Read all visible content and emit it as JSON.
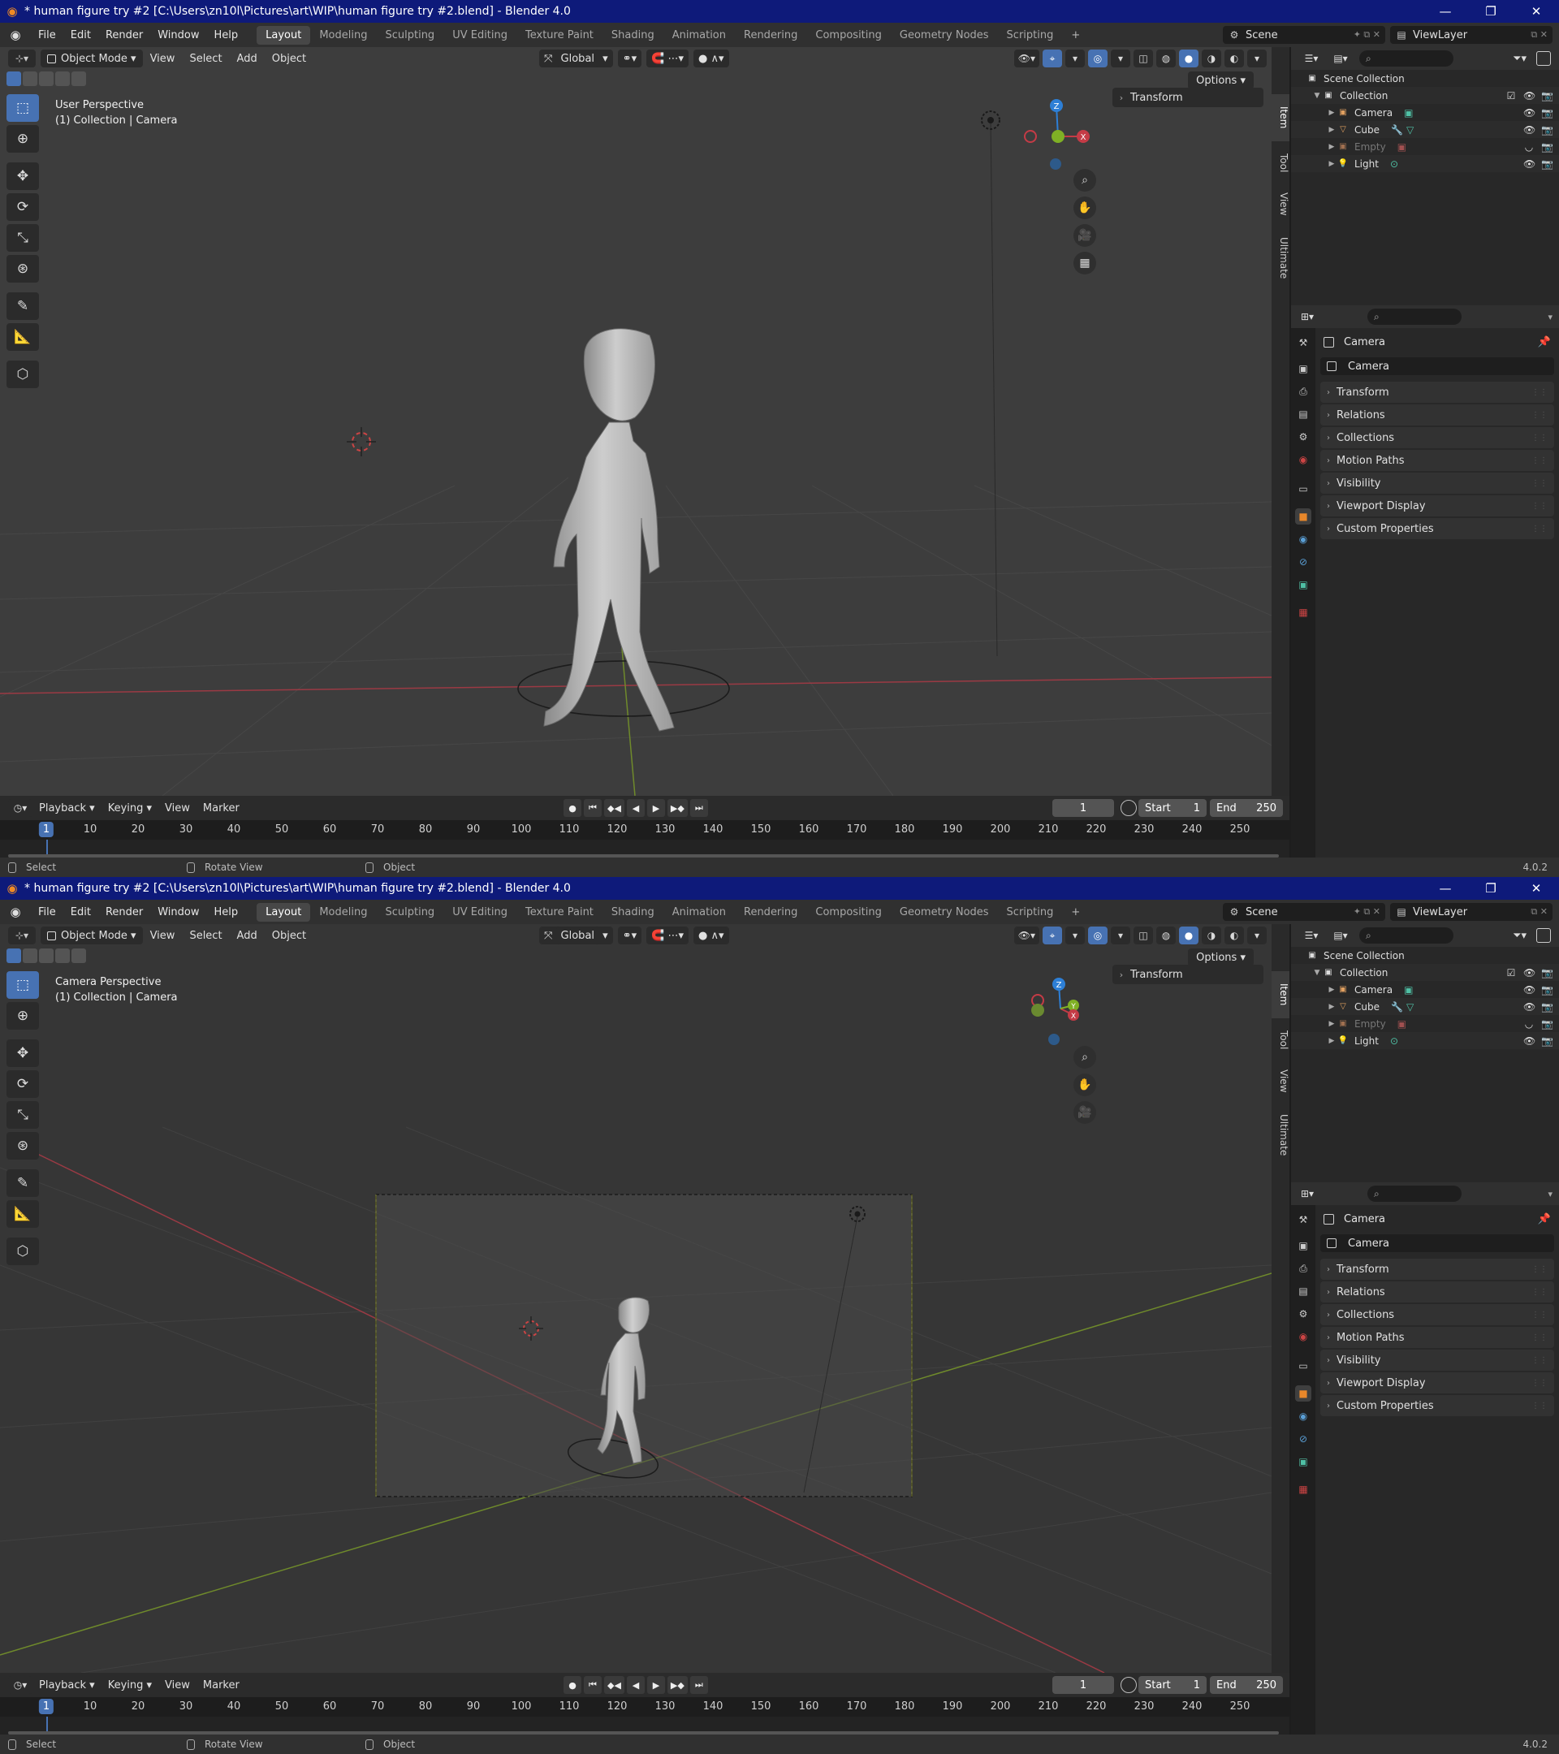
{
  "windows": [
    {
      "title": "* human figure try #2 [C:\\Users\\zn10l\\Pictures\\art\\WIP\\human figure try #2.blend] - Blender 4.0",
      "menu": [
        "File",
        "Edit",
        "Render",
        "Window",
        "Help"
      ],
      "workspaces": [
        "Layout",
        "Modeling",
        "Sculpting",
        "UV Editing",
        "Texture Paint",
        "Shading",
        "Animation",
        "Rendering",
        "Compositing",
        "Geometry Nodes",
        "Scripting",
        "+"
      ],
      "scene": "Scene",
      "view_layer": "ViewLayer",
      "viewport": {
        "mode": "Object Mode",
        "header_items": [
          "View",
          "Select",
          "Add",
          "Object"
        ],
        "orientation": "Global",
        "options": "Options",
        "info_line1": "User Perspective",
        "info_line2": "(1) Collection | Camera",
        "npanel_header": "Transform",
        "ntabs": [
          "Item",
          "Tool",
          "View",
          "Ultimate"
        ]
      },
      "timeline": {
        "items": [
          "Playback",
          "Keying",
          "View",
          "Marker"
        ],
        "current_frame": "1",
        "start_label": "Start",
        "start": "1",
        "end_label": "End",
        "end": "250",
        "ticks": [
          "1",
          "10",
          "20",
          "30",
          "40",
          "50",
          "60",
          "70",
          "80",
          "90",
          "100",
          "110",
          "120",
          "130",
          "140",
          "150",
          "160",
          "170",
          "180",
          "190",
          "200",
          "210",
          "220",
          "230",
          "240",
          "250"
        ]
      },
      "status": [
        "Select",
        "Rotate View",
        "Object"
      ],
      "version": "4.0.2"
    },
    {
      "title": "* human figure try #2 [C:\\Users\\zn10l\\Pictures\\art\\WIP\\human figure try #2.blend] - Blender 4.0",
      "menu": [
        "File",
        "Edit",
        "Render",
        "Window",
        "Help"
      ],
      "workspaces": [
        "Layout",
        "Modeling",
        "Sculpting",
        "UV Editing",
        "Texture Paint",
        "Shading",
        "Animation",
        "Rendering",
        "Compositing",
        "Geometry Nodes",
        "Scripting",
        "+"
      ],
      "scene": "Scene",
      "view_layer": "ViewLayer",
      "viewport": {
        "mode": "Object Mode",
        "header_items": [
          "View",
          "Select",
          "Add",
          "Object"
        ],
        "orientation": "Global",
        "options": "Options",
        "info_line1": "Camera Perspective",
        "info_line2": "(1) Collection | Camera",
        "npanel_header": "Transform",
        "ntabs": [
          "Item",
          "Tool",
          "View",
          "Ultimate"
        ]
      },
      "timeline": {
        "items": [
          "Playback",
          "Keying",
          "View",
          "Marker"
        ],
        "current_frame": "1",
        "start_label": "Start",
        "start": "1",
        "end_label": "End",
        "end": "250",
        "ticks": [
          "1",
          "10",
          "20",
          "30",
          "40",
          "50",
          "60",
          "70",
          "80",
          "90",
          "100",
          "110",
          "120",
          "130",
          "140",
          "150",
          "160",
          "170",
          "180",
          "190",
          "200",
          "210",
          "220",
          "230",
          "240",
          "250"
        ]
      },
      "status": [
        "Select",
        "Rotate View",
        "Object"
      ],
      "version": "4.0.2"
    }
  ],
  "outliner": {
    "root": "Scene Collection",
    "collection": "Collection",
    "items": [
      {
        "name": "Camera",
        "icon": "camera-icon",
        "color": "#e0a060",
        "extra": "camera-data-icon",
        "dim": false
      },
      {
        "name": "Cube",
        "icon": "mesh-icon",
        "color": "#e0a060",
        "extra": "modifier-and-mesh-data-icons",
        "dim": false
      },
      {
        "name": "Empty",
        "icon": "empty-icon",
        "color": "#e0a060",
        "extra": "empty-image-icon",
        "dim": true
      },
      {
        "name": "Light",
        "icon": "light-icon",
        "color": "#e0a060",
        "extra": "light-data-icon",
        "dim": false
      }
    ]
  },
  "properties": {
    "object_name": "Camera",
    "name_field": "Camera",
    "panels": [
      "Transform",
      "Relations",
      "Collections",
      "Motion Paths",
      "Visibility",
      "Viewport Display",
      "Custom Properties"
    ]
  },
  "colors": {
    "titlebar": "#0e1a7a",
    "accent": "#4772b3",
    "viewport_bg": "#3d3d3d",
    "x_axis": "#c43b46",
    "y_axis": "#7fb025",
    "z_axis": "#2d7fd6"
  }
}
